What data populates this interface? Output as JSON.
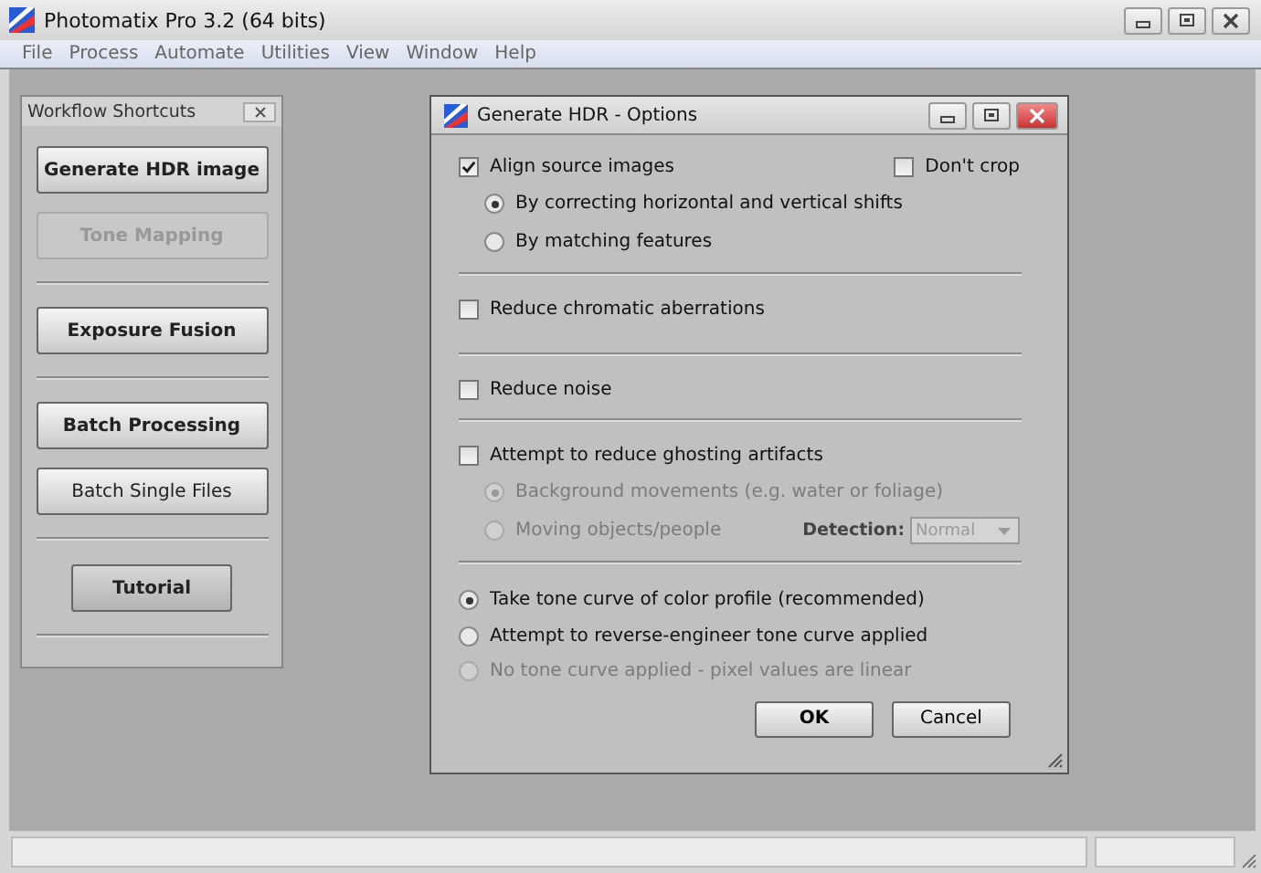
{
  "window": {
    "title": "Photomatix Pro 3.2 (64 bits)"
  },
  "menu": [
    "File",
    "Process",
    "Automate",
    "Utilities",
    "View",
    "Window",
    "Help"
  ],
  "shortcuts": {
    "title": "Workflow Shortcuts",
    "items": [
      {
        "kind": "button",
        "label": "Generate HDR image",
        "bold": true,
        "disabled": false
      },
      {
        "kind": "button",
        "label": "Tone Mapping",
        "bold": true,
        "disabled": true
      },
      {
        "kind": "divider"
      },
      {
        "kind": "button",
        "label": "Exposure Fusion",
        "bold": true,
        "disabled": false
      },
      {
        "kind": "divider"
      },
      {
        "kind": "button",
        "label": "Batch Processing",
        "bold": true,
        "disabled": false
      },
      {
        "kind": "button",
        "label": "Batch Single Files",
        "bold": false,
        "disabled": false
      },
      {
        "kind": "divider"
      },
      {
        "kind": "small-button",
        "label": "Tutorial",
        "bold": true,
        "disabled": false
      },
      {
        "kind": "divider"
      }
    ]
  },
  "dialog": {
    "title": "Generate HDR - Options",
    "align": {
      "label": "Align source images",
      "checked": true
    },
    "dont_crop": {
      "label": "Don't crop",
      "checked": false
    },
    "align_methods": [
      {
        "label": "By correcting horizontal and vertical shifts",
        "selected": true,
        "disabled": false
      },
      {
        "label": "By matching features",
        "selected": false,
        "disabled": false
      }
    ],
    "chromatic": {
      "label": "Reduce chromatic aberrations",
      "checked": false
    },
    "noise": {
      "label": "Reduce noise",
      "checked": false
    },
    "ghosting": {
      "label": "Attempt to reduce ghosting artifacts",
      "checked": false
    },
    "ghost_modes": [
      {
        "label": "Background movements (e.g. water or foliage)",
        "selected": true,
        "disabled": true
      },
      {
        "label": "Moving objects/people",
        "selected": false,
        "disabled": true
      }
    ],
    "detection": {
      "label": "Detection:",
      "value": "Normal",
      "disabled": true
    },
    "tone_curves": [
      {
        "label": "Take tone curve of color profile (recommended)",
        "selected": true,
        "disabled": false
      },
      {
        "label": "Attempt to reverse-engineer tone curve applied",
        "selected": false,
        "disabled": false
      },
      {
        "label": "No tone curve applied - pixel values are linear",
        "selected": false,
        "disabled": true
      }
    ],
    "buttons": [
      "OK",
      "Cancel"
    ]
  }
}
